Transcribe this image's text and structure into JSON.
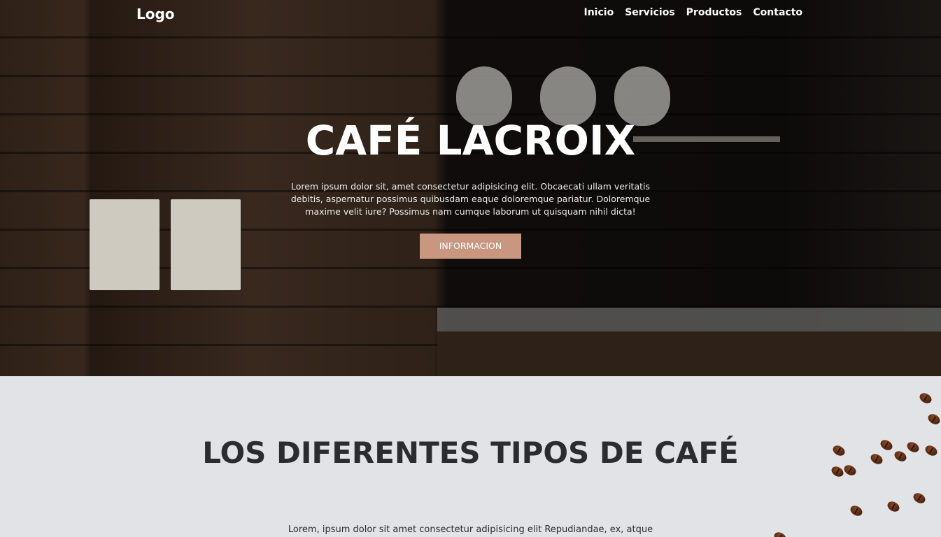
{
  "navbar": {
    "logo": "Logo",
    "links": [
      "Inicio",
      "Servicios",
      "Productos",
      "Contacto"
    ]
  },
  "hero": {
    "title": "CAFÉ LACROIX",
    "text": "Lorem ipsum dolor sit, amet consectetur adipisicing elit. Obcaecati ullam veritatis debitis, aspernatur possimus quibusdam eaque doloremque pariatur. Doloremque maxime velit iure? Possimus nam cumque laborum ut quisquam nihil dicta!",
    "button": "INFORMACION",
    "button_color": "#c99680"
  },
  "section": {
    "title": "LOS DIFERENTES TIPOS DE CAFÉ",
    "text": "Lorem, ipsum dolor sit amet consectetur adipisicing elit Repudiandae, ex, atque",
    "background": "#e2e3e7"
  }
}
